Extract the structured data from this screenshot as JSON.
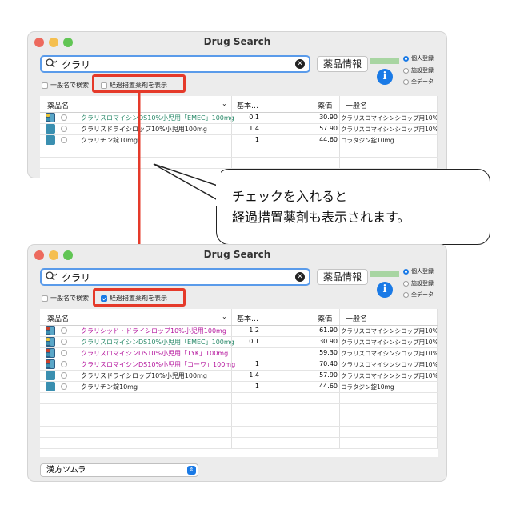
{
  "window_title": "Drug Search",
  "search_value": "クラリ",
  "info_button": "薬品情報",
  "radio_options": [
    "個人登録",
    "施設登録",
    "全データ"
  ],
  "generic_search_label": "一般名で検索",
  "show_transitional_label": "経過措置薬剤を表示",
  "columns": {
    "name": "薬品名",
    "base": "基本…",
    "price": "薬価",
    "generic": "一般名"
  },
  "table1_rows": [
    {
      "name": "クラリスロマイシンDS10%小児用「EMEC」100mg",
      "base": "0.1",
      "price": "30.90",
      "generic": "クラリスロマイシンシロップ用10%",
      "color": "#2a8a6a",
      "icon": "yellow-dark"
    },
    {
      "name": "クラリスドライシロップ10%小児用100mg",
      "base": "1.4",
      "price": "57.90",
      "generic": "クラリスロマイシンシロップ用10%",
      "color": "#222222",
      "icon": "teal"
    },
    {
      "name": "クラリチン錠10mg",
      "base": "1",
      "price": "44.60",
      "generic": "ロラタジン錠10mg",
      "color": "#222222",
      "icon": "teal"
    }
  ],
  "table2_rows": [
    {
      "name": "クラリシッド・ドライシロップ10%小児用100mg",
      "base": "1.2",
      "price": "61.90",
      "generic": "クラリスロマイシンシロップ用10%",
      "color": "#b5179e",
      "icon": "red-dark"
    },
    {
      "name": "クラリスロマイシンDS10%小児用「EMEC」100mg",
      "base": "0.1",
      "price": "30.90",
      "generic": "クラリスロマイシンシロップ用10%",
      "color": "#2a8a6a",
      "icon": "yellow-dark"
    },
    {
      "name": "クラリスロマイシンDS10%小児用「TYK」100mg",
      "base": "",
      "price": "59.30",
      "generic": "クラリスロマイシンシロップ用10%",
      "color": "#b5179e",
      "icon": "red-dark"
    },
    {
      "name": "クラリスロマイシンDS10%小児用「コーワ」100mg",
      "base": "1",
      "price": "70.40",
      "generic": "クラリスロマイシンシロップ用10%",
      "color": "#b5179e",
      "icon": "red-dark"
    },
    {
      "name": "クラリスドライシロップ10%小児用100mg",
      "base": "1.4",
      "price": "57.90",
      "generic": "クラリスロマイシンシロップ用10%",
      "color": "#222222",
      "icon": "teal"
    },
    {
      "name": "クラリチン錠10mg",
      "base": "1",
      "price": "44.60",
      "generic": "ロラタジン錠10mg",
      "color": "#222222",
      "icon": "teal"
    }
  ],
  "callout_line1": "チェックを入れると",
  "callout_line2": "経過措置薬剤も表示されます。",
  "popup_label": "漢方ツムラ",
  "colors": {
    "highlight": "#e53a2a",
    "accent": "#1a7ae6",
    "teal_icon": "#3a8fb0"
  }
}
